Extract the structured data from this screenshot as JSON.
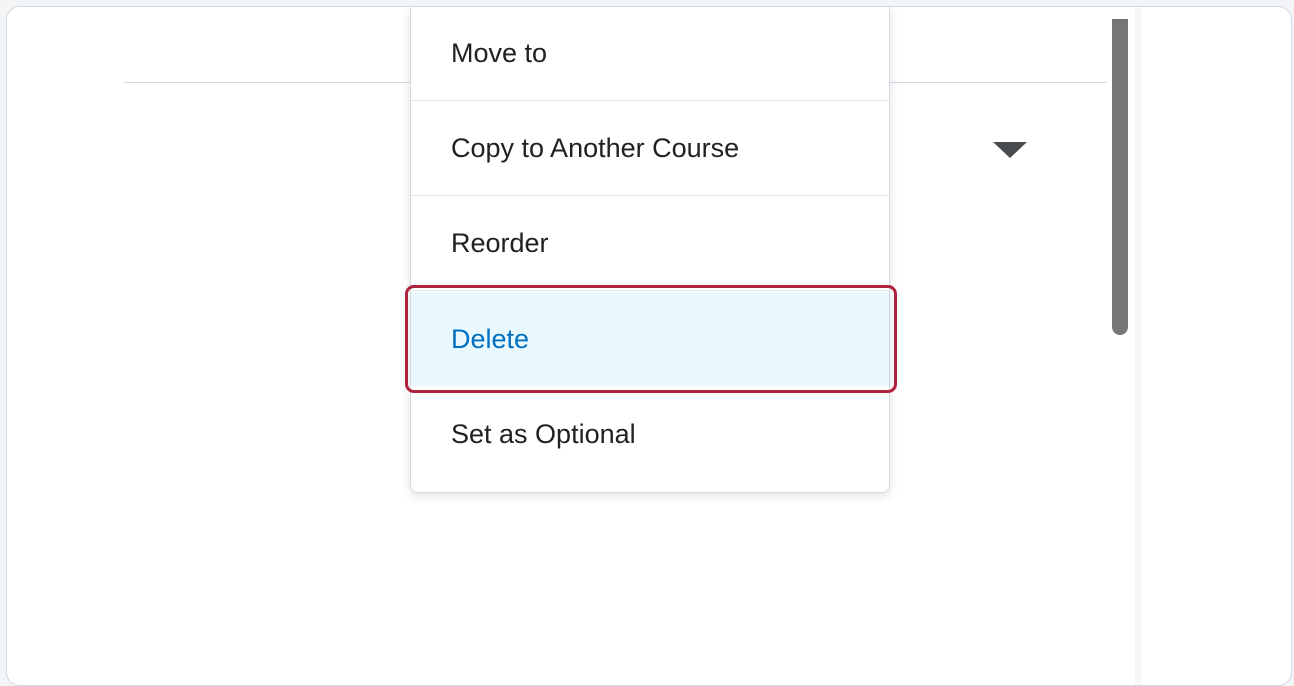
{
  "menu": {
    "items": [
      {
        "label": "Move to"
      },
      {
        "label": "Copy to Another Course"
      },
      {
        "label": "Reorder"
      },
      {
        "label": "Delete"
      },
      {
        "label": "Set as Optional"
      }
    ],
    "highlighted_index": 3
  },
  "colors": {
    "highlight_bg": "#e8f8fd",
    "highlight_text": "#006fbf",
    "focus_ring": "#b0223d"
  },
  "icons": {
    "dropdown": "caret-down-icon"
  }
}
